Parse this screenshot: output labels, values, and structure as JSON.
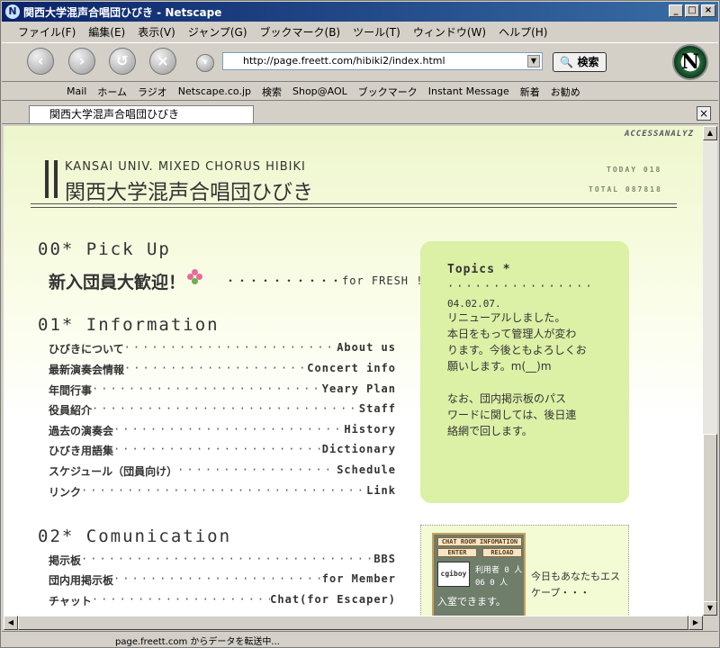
{
  "window": {
    "title": "関西大学混声合唱団ひびき - Netscape"
  },
  "menu": [
    "ファイル(F)",
    "編集(E)",
    "表示(V)",
    "ジャンプ(G)",
    "ブックマーク(B)",
    "ツール(T)",
    "ウィンドウ(W)",
    "ヘルプ(H)"
  ],
  "nav": {
    "url": "http://page.freett.com/hibiki2/index.html",
    "search_label": "検索"
  },
  "personal_toolbar": [
    "Mail",
    "ホーム",
    "ラジオ",
    "Netscape.co.jp",
    "検索",
    "Shop@AOL",
    "ブックマーク",
    "Instant Message",
    "新着",
    "お勧め"
  ],
  "tab": {
    "label": "関西大学混声合唱団ひびき"
  },
  "page": {
    "access_analyzer": "ACCESSANALYZ",
    "header_en": "KANSAI UNIV. MIXED CHORUS HIBIKI",
    "header_ja": "関西大学混声合唱団ひびき",
    "today": "TODAY 018",
    "total": "TOTAL 087818",
    "pick_heading": "00* Pick Up",
    "pick_text": "新入団員大歓迎！",
    "pick_link": "・・・・・・・・・・for FRESH !",
    "info_heading": "01* Information",
    "info_items": [
      {
        "ja": "ひびきについて",
        "en": "About us"
      },
      {
        "ja": "最新演奏会情報",
        "en": "Concert info"
      },
      {
        "ja": "年間行事",
        "en": "Yeary Plan"
      },
      {
        "ja": "役員紹介",
        "en": "Staff"
      },
      {
        "ja": "過去の演奏会",
        "en": "History"
      },
      {
        "ja": "ひびき用語集",
        "en": "Dictionary"
      },
      {
        "ja": "スケジュール（団員向け）",
        "en": "Schedule"
      },
      {
        "ja": "リンク",
        "en": "Link"
      }
    ],
    "comm_heading": "02* Comunication",
    "comm_items": [
      {
        "ja": "掲示板",
        "en": "BBS"
      },
      {
        "ja": "団内用掲示板",
        "en": "for Member"
      },
      {
        "ja": "チャット",
        "en": "Chat(for Escaper)"
      }
    ],
    "topics": {
      "title": "Topics *",
      "date": "04.02.07.",
      "body": "リニューアルしました。\n本日をもって管理人が変わ\nります。今後ともよろしくお\n願いします。m(__)m",
      "body2": "なお、団内掲示板のパス\nワードに関しては、後日連\n絡網で回します。"
    },
    "chat": {
      "info_label": "CHAT ROOM INFOMATION",
      "enter": "ENTER",
      "reload": "RELOAD",
      "logo": "cgiboy",
      "count1": "利用者 0 人",
      "count2": "06 0 人",
      "enter_text": "入室できます。",
      "side_text": "今日もあなたもエスケープ・・・"
    }
  },
  "status": {
    "text": "page.freett.com からデータを転送中..."
  }
}
